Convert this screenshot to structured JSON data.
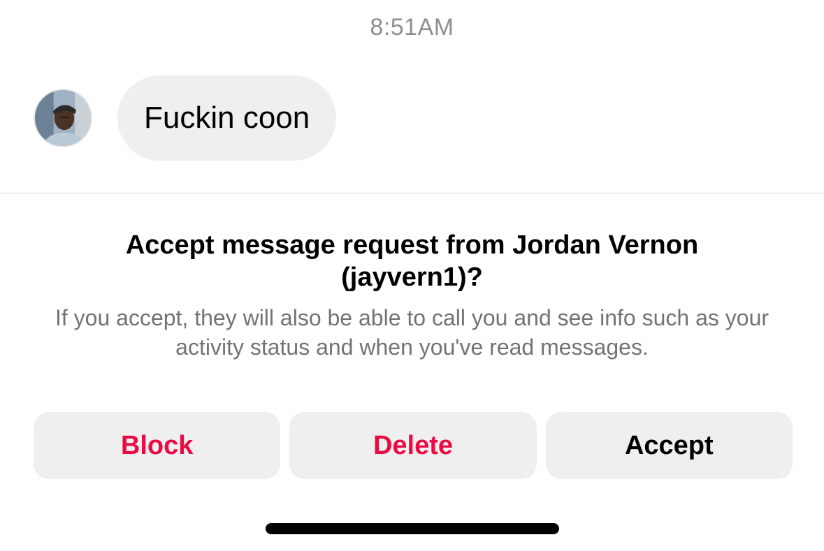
{
  "timestamp": "8:51AM",
  "message": {
    "avatar_icon": "profile-photo",
    "text": "Fuckin coon"
  },
  "request": {
    "title": "Accept message request from Jordan Vernon (jayvern1)?",
    "body": "If you accept, they will also be able to call you and see info such as your activity status and when you've read messages."
  },
  "actions": {
    "block_label": "Block",
    "delete_label": "Delete",
    "accept_label": "Accept"
  },
  "colors": {
    "danger": "#ed0a43",
    "bubble": "#efefef",
    "muted_text": "#737373",
    "timestamp_text": "#8e8e8e"
  }
}
